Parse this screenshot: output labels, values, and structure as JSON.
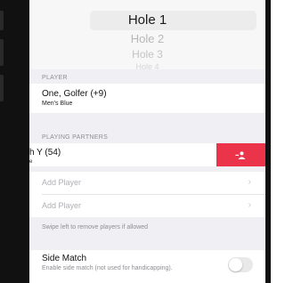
{
  "hole_picker": {
    "options": [
      "Hole 1",
      "Hole 2",
      "Hole 3",
      "Hole 4"
    ],
    "selected": "Hole 1"
  },
  "player_section": {
    "header": "PLAYER",
    "name": "One, Golfer (+9)",
    "tee": "Men's Blue"
  },
  "partners_section": {
    "header": "PLAYING PARTNERS",
    "swiped_row": {
      "name_visible": "h Y (54)",
      "sub_visible": "e",
      "action_icon": "remove-person-icon",
      "action_color": "#eb3349"
    },
    "add_player_rows": [
      {
        "placeholder": "Add Player",
        "chevron": "›"
      },
      {
        "placeholder": "Add Player",
        "chevron": "›"
      }
    ],
    "hint": "Swipe left to remove players if allowed"
  },
  "side_match": {
    "title": "Side Match",
    "description": "Enable side match (not used for handicapping).",
    "enabled": false
  }
}
